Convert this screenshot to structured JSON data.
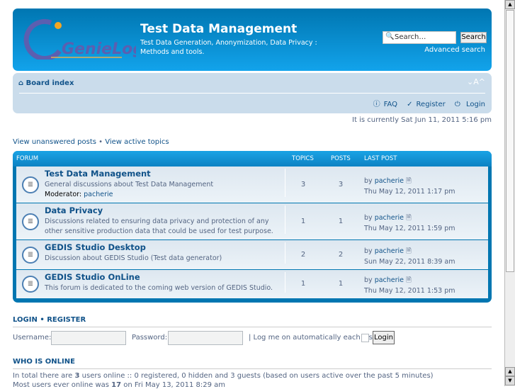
{
  "header": {
    "logo_text": "GenieLog",
    "title": "Test Data Management",
    "description": "Test Data Generation, Anonymization, Data Privacy : Methods and tools.",
    "search_placeholder": "Search…",
    "search_button": "Search",
    "advanced_search": "Advanced search"
  },
  "nav": {
    "board_index": "Board index",
    "font_size": "⌄A^",
    "faq": "FAQ",
    "register": "Register",
    "login": "Login"
  },
  "current_time": "It is currently Sat Jun 11, 2011 5:16 pm",
  "quick_links": {
    "unanswered": "View unanswered posts",
    "sep": "•",
    "active": "View active topics"
  },
  "table": {
    "headers": {
      "forum": "FORUM",
      "topics": "TOPICS",
      "posts": "POSTS",
      "last_post": "LAST POST"
    },
    "rows": [
      {
        "name": "Test Data Management",
        "desc": "General discussions about Test Data Management",
        "moderator_label": "Moderator:",
        "moderator": "pacherie",
        "topics": "3",
        "posts": "3",
        "by": "by",
        "author": "pacherie",
        "date": "Thu May 12, 2011 1:17 pm"
      },
      {
        "name": "Data Privacy",
        "desc": "Discussions related to ensuring data privacy and protection of any other sensitive production data that could be used for test purpose.",
        "topics": "1",
        "posts": "1",
        "by": "by",
        "author": "pacherie",
        "date": "Thu May 12, 2011 1:59 pm"
      },
      {
        "name": "GEDIS Studio Desktop",
        "desc": "Discussion about GEDIS Studio (Test data generator)",
        "topics": "2",
        "posts": "2",
        "by": "by",
        "author": "pacherie",
        "date": "Sun May 22, 2011 8:39 am"
      },
      {
        "name": "GEDIS Studio OnLine",
        "desc": "This forum is dedicated to the coming web version of GEDIS Studio.",
        "topics": "1",
        "posts": "1",
        "by": "by",
        "author": "pacherie",
        "date": "Thu May 12, 2011 1:53 pm"
      }
    ]
  },
  "login": {
    "heading_login": "LOGIN",
    "sep": "•",
    "heading_register": "REGISTER",
    "username_label": "Username:",
    "password_label": "Password:",
    "auto_label": "| Log me on automatically each visit",
    "button": "Login"
  },
  "online": {
    "heading": "WHO IS ONLINE",
    "line1_a": "In total there are ",
    "line1_b": "3",
    "line1_c": " users online :: 0 registered, 0 hidden and 3 guests (based on users active over the past 5 minutes)",
    "line2_a": "Most users ever online was ",
    "line2_b": "17",
    "line2_c": " on Fri May 13, 2011 8:29 am"
  }
}
